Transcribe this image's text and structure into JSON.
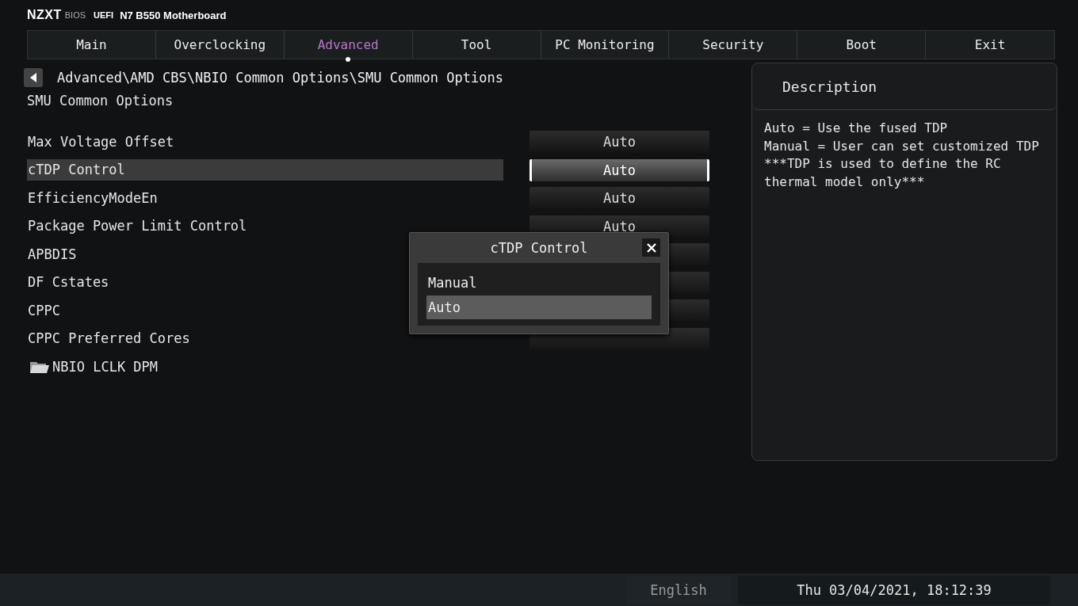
{
  "header": {
    "brand": "NZXT",
    "bios": "BIOS",
    "uefi": "UEFI",
    "board": "N7 B550 Motherboard"
  },
  "tabs": [
    {
      "label": "Main",
      "selected": false
    },
    {
      "label": "Overclocking",
      "selected": false
    },
    {
      "label": "Advanced",
      "selected": true
    },
    {
      "label": "Tool",
      "selected": false
    },
    {
      "label": "PC Monitoring",
      "selected": false
    },
    {
      "label": "Security",
      "selected": false
    },
    {
      "label": "Boot",
      "selected": false
    },
    {
      "label": "Exit",
      "selected": false
    }
  ],
  "breadcrumb": "Advanced\\AMD CBS\\NBIO Common Options\\SMU Common Options",
  "page_title": "SMU Common Options",
  "settings": [
    {
      "kind": "option",
      "label": "Max Voltage Offset",
      "value": "Auto",
      "selected": false
    },
    {
      "kind": "option",
      "label": "cTDP Control",
      "value": "Auto",
      "selected": true
    },
    {
      "kind": "option",
      "label": "EfficiencyModeEn",
      "value": "Auto",
      "selected": false
    },
    {
      "kind": "option",
      "label": "Package Power Limit Control",
      "value": "Auto",
      "selected": false
    },
    {
      "kind": "option",
      "label": "APBDIS",
      "selected": false
    },
    {
      "kind": "option",
      "label": "DF Cstates",
      "selected": false
    },
    {
      "kind": "option",
      "label": "CPPC",
      "selected": false
    },
    {
      "kind": "option",
      "label": "CPPC Preferred Cores",
      "selected": false
    },
    {
      "kind": "folder",
      "label": "NBIO LCLK DPM",
      "selected": false
    }
  ],
  "popup": {
    "title": "cTDP Control",
    "options": [
      {
        "label": "Manual",
        "selected": false
      },
      {
        "label": "Auto",
        "selected": true
      }
    ]
  },
  "description": {
    "title": "Description",
    "lines": [
      "Auto = Use the fused TDP",
      "Manual = User can set customized TDP",
      "***TDP is used to define the RC",
      "thermal model only***"
    ]
  },
  "status_bar": {
    "language": "English",
    "datetime": "Thu 03/04/2021, 18:12:39"
  }
}
